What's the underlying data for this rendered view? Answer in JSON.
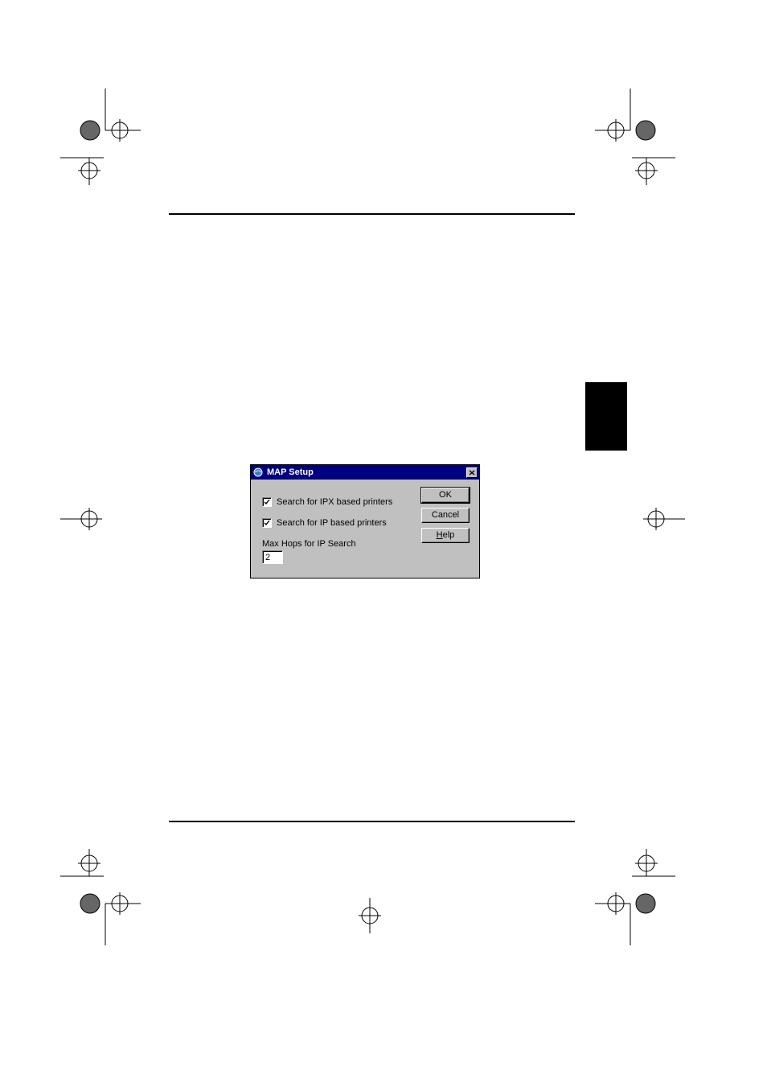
{
  "dialog": {
    "title": "MAP Setup",
    "checkbox_ipx_label": "Search for IPX based printers",
    "checkbox_ip_label": "Search for IP based printers",
    "maxhops_label": "Max Hops for IP Search",
    "maxhops_value": "2",
    "buttons": {
      "ok": "OK",
      "cancel": "Cancel",
      "help_prefix": "H",
      "help_rest": "elp"
    }
  }
}
